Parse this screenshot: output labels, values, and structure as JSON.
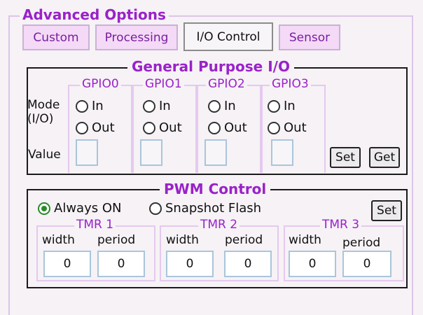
{
  "advanced_options": {
    "title": "Advanced Options",
    "tabs": [
      "Custom",
      "Processing",
      "I/O Control",
      "Sensor"
    ],
    "active_tab": "I/O Control"
  },
  "gpio": {
    "title": "General Purpose I/O",
    "mode_label": "Mode\n(I/O)",
    "value_label": "Value",
    "channels": [
      {
        "name": "GPIO0",
        "in": "In",
        "out": "Out"
      },
      {
        "name": "GPIO1",
        "in": "In",
        "out": "Out"
      },
      {
        "name": "GPIO2",
        "in": "In",
        "out": "Out"
      },
      {
        "name": "GPIO3",
        "in": "In",
        "out": "Out"
      }
    ],
    "set_label": "Set",
    "get_label": "Get"
  },
  "pwm": {
    "title": "PWM Control",
    "always_on_label": "Always ON",
    "snapshot_label": "Snapshot Flash",
    "selected": "Always ON",
    "set_label": "Set",
    "timers": [
      {
        "name": "TMR 1",
        "width_label": "width",
        "period_label": "period",
        "width": "0",
        "period": "0"
      },
      {
        "name": "TMR 2",
        "width_label": "width",
        "period_label": "period",
        "width": "0",
        "period": "0"
      },
      {
        "name": "TMR 3",
        "width_label": "width",
        "period_label": "period",
        "width": "0",
        "period": "0"
      }
    ]
  },
  "colors": {
    "accent": "#9a22c8",
    "tab_bg": "#f4daf7",
    "radio_selected": "#2a8a2a"
  }
}
